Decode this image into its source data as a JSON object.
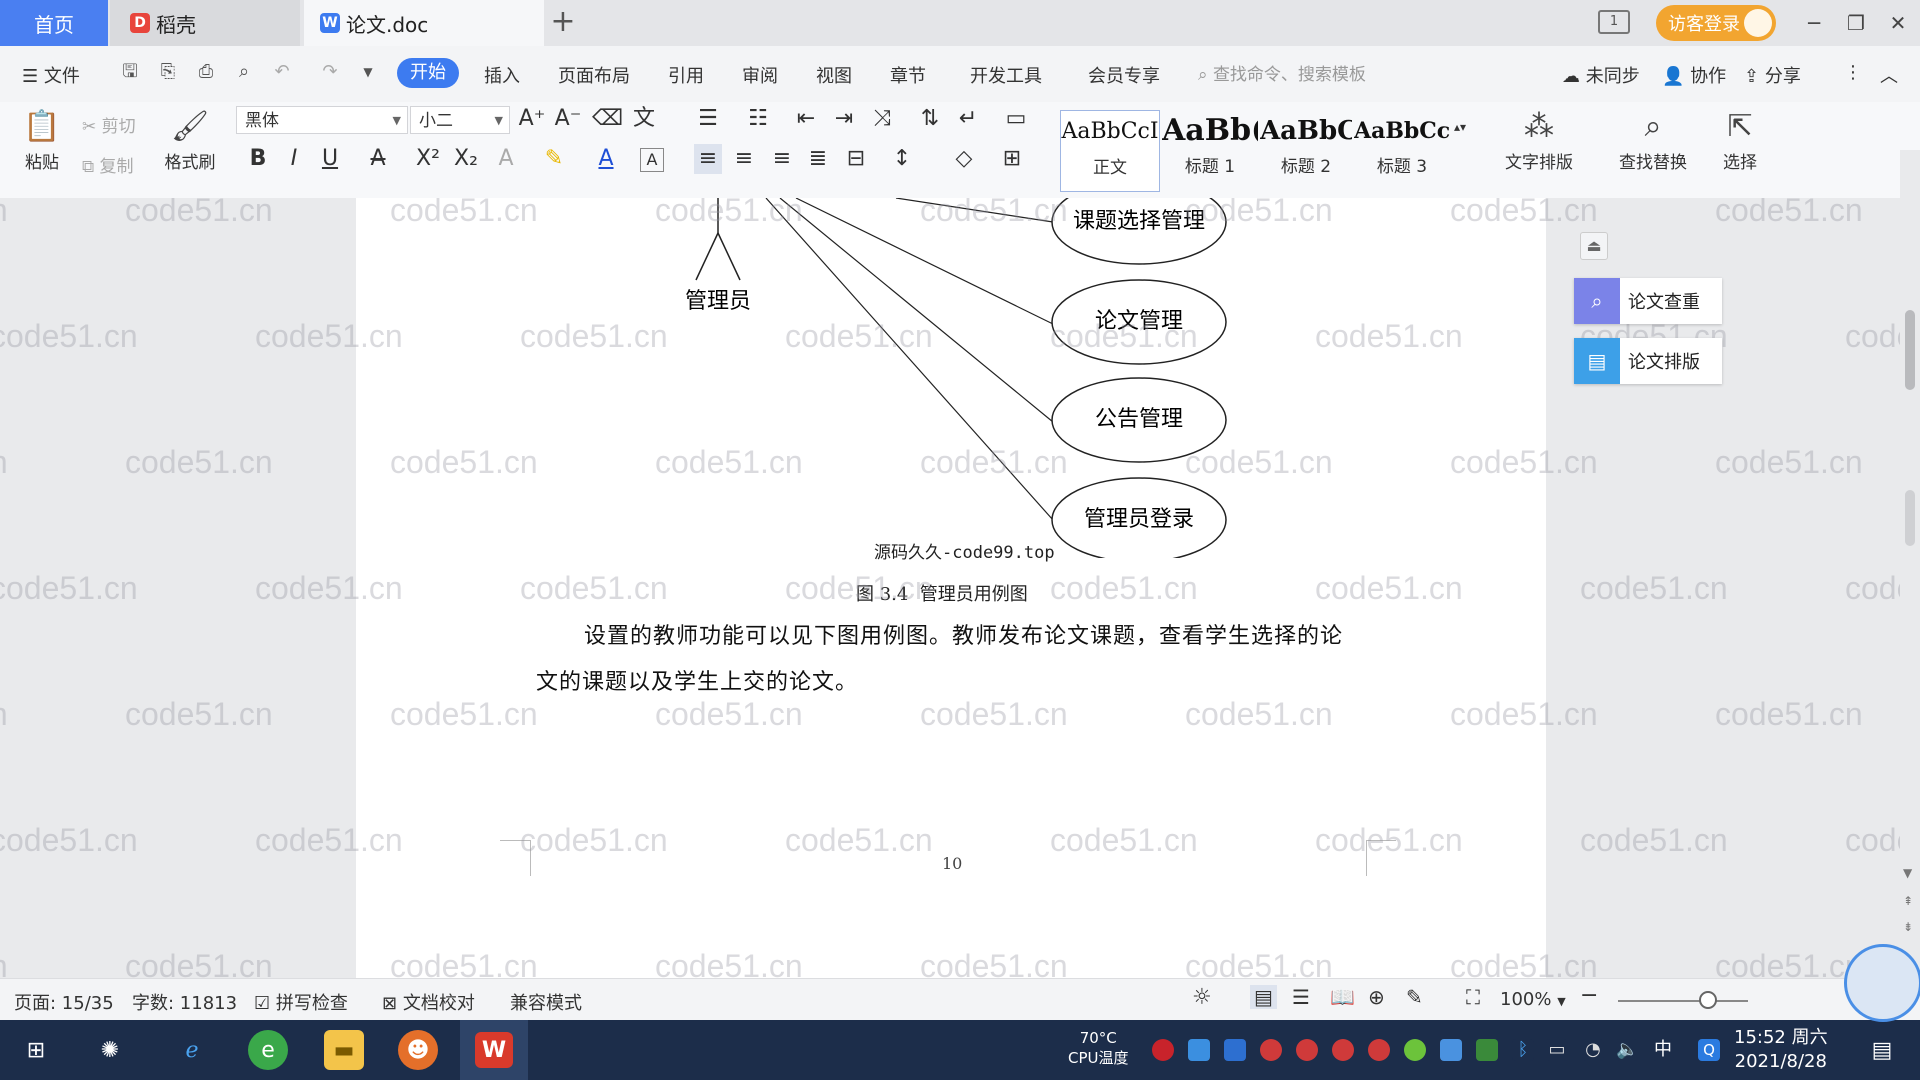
{
  "titlebar": {
    "tabs": [
      {
        "label": "首页"
      },
      {
        "label": "稻壳"
      },
      {
        "label": "论文.doc"
      }
    ],
    "login_label": "访客登录",
    "layout_icon": "1"
  },
  "menubar": {
    "file_label": "文件",
    "items": [
      "开始",
      "插入",
      "页面布局",
      "引用",
      "审阅",
      "视图",
      "章节",
      "开发工具",
      "会员专享"
    ],
    "search_placeholder": "查找命令、搜索模板",
    "sync_label": "未同步",
    "collab_label": "协作",
    "share_label": "分享"
  },
  "ribbon": {
    "paste_label": "粘贴",
    "cut_label": "剪切",
    "copy_label": "复制",
    "format_painter_label": "格式刷",
    "font_name": "黑体",
    "font_size": "小二",
    "styles": [
      {
        "sample": "AaBbCcI",
        "label": "正文"
      },
      {
        "sample": "AaBb(",
        "label": "标题 1"
      },
      {
        "sample": "AaBbC",
        "label": "标题 2"
      },
      {
        "sample": "AaBbCcl",
        "label": "标题 3"
      }
    ],
    "text_layout_label": "文字排版",
    "find_replace_label": "查找替换",
    "select_label": "选择"
  },
  "document": {
    "watermark_text": "code51.cn",
    "actor_label": "管理员",
    "use_cases": [
      "课题选择管理",
      "论文管理",
      "公告管理",
      "管理员登录"
    ],
    "source_watermark": "源码久久-code99.top",
    "figure_caption": "图 3.4  管理员用例图",
    "paragraph_line1": "设置的教师功能可以见下图用例图。教师发布论文课题，查看学生选择的论",
    "paragraph_line2": "文的课题以及学生上交的论文。",
    "page_number": "10"
  },
  "side_panel": {
    "items": [
      {
        "label": "论文查重",
        "color": "#7b83e8"
      },
      {
        "label": "论文排版",
        "color": "#3da0e8"
      }
    ]
  },
  "statusbar": {
    "page": "页面: 15/35",
    "words": "字数: 11813",
    "spell_check": "拼写检查",
    "doc_proof": "文档校对",
    "compat_mode": "兼容模式",
    "zoom": "100%",
    "zoom_fraction": 0.69
  },
  "taskbar": {
    "cpu_temp": "70°C",
    "cpu_label": "CPU温度",
    "time": "15:52 周六",
    "date": "2021/8/28",
    "ime": "中"
  },
  "colors": {
    "accent": "#3d7bf0",
    "home_tab": "#4a7ff1",
    "login": "#f2a530",
    "taskbar": "#1c2d4a"
  }
}
